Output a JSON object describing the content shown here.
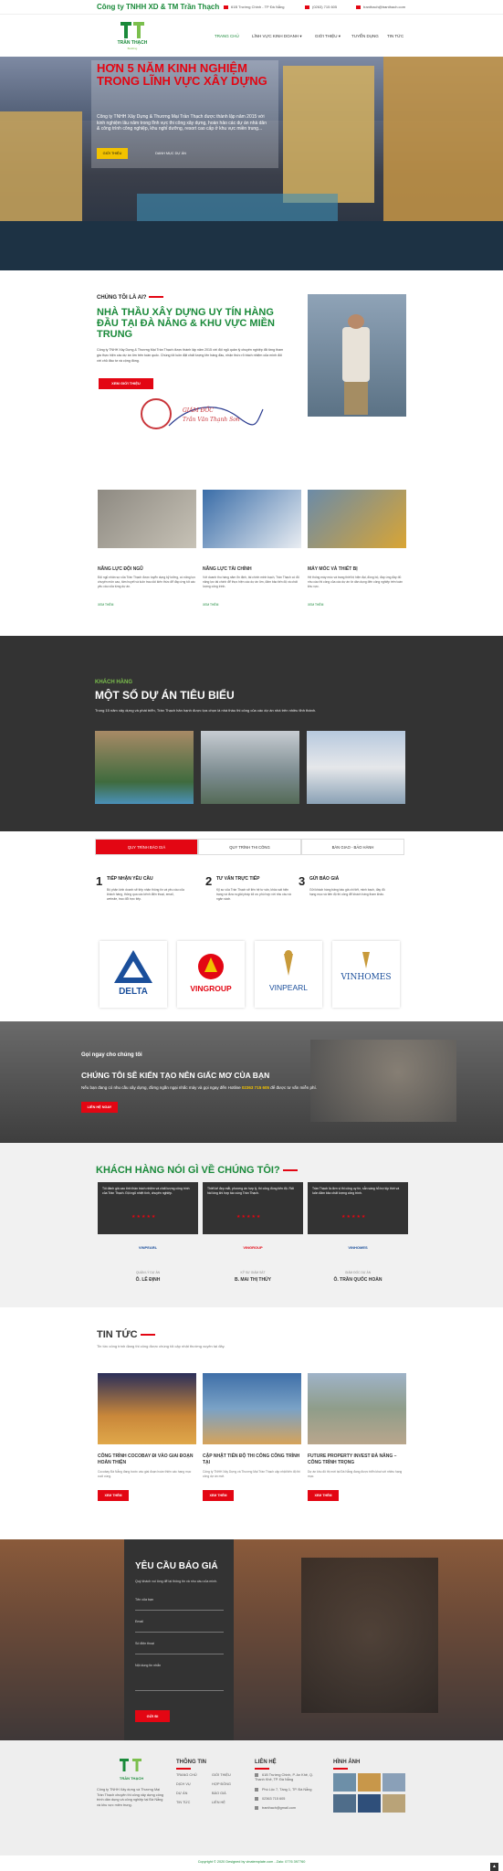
{
  "topbar": {
    "brand": "Công ty TNHH XD & TM Trần Thạch",
    "address": "61B Trường Chinh - TP Đà Nẵng",
    "phone": "(0263) 715 605",
    "email": "tranthach@tranthach.com"
  },
  "logo": {
    "name": "TRẦN THẠCH",
    "tagline": "Building"
  },
  "nav": {
    "items": [
      "TRANG CHỦ",
      "LĨNH VỰC KINH DOANH ▾",
      "GIỚI THIỆU ▾",
      "TUYỂN DỤNG",
      "TIN TỨC"
    ]
  },
  "hero": {
    "title": "HƠN 5 NĂM KINH NGHIỆM TRONG LĨNH VỰC XÂY DỰNG",
    "desc": "Công ty TNHH Xây Dựng & Thương Mại Trần Thạch được thành lập năm 2015 với kinh nghiệm lâu năm trong lĩnh vực thi công xây dựng, hoàn hảo các dự án nhà dân & công trình công nghiệp, khu nghỉ dưỡng, resort cao cấp ở khu vực miền trung...",
    "btn_primary": "GIỚI THIỆU",
    "btn_secondary": "DANH MỤC DỰ ÁN"
  },
  "about": {
    "kicker": "CHÚNG TÔI LÀ AI?",
    "title": "NHÀ THẦU XÂY DỰNG UY TÍN HÀNG ĐẦU TẠI ĐÀ NẴNG & KHU VỰC MIỀN TRUNG",
    "text": "Công ty TNHH Xây Dựng & Thương Mại Trần Thạch được thành lập năm 2015 với đội ngũ quản lý chuyên nghiệp đã từng tham gia thực hiện các dự án lớn trên toàn quốc. Chúng tôi luôn đặt chất lượng lên hàng đầu, nhận thức rõ trách nhiệm của mình đối với chủ đầu tư và cộng đồng.",
    "button": "XEM GIỚI THIỆU",
    "signature_title": "GIÁM ĐỐC",
    "signature_name": "Trần Văn Thạnh Sơn"
  },
  "capabilities": [
    {
      "title": "NĂNG LỰC ĐỘI NGŨ",
      "text": "Đội ngũ nhân sự của Trần Thạch được tuyển dụng kỹ lưỡng, có năng lực chuyên môn cao, tâm huyết và luôn trau dồi kiến thức để đáp ứng tốt các yêu cầu của từng dự án.",
      "link": "XEM THÊM"
    },
    {
      "title": "NĂNG LỰC TÀI CHÍNH",
      "text": "Với doanh thu hàng năm ổn định, tài chính minh bạch, Trần Thạch có đủ năng lực tài chính để thực hiện các dự án lớn, đảm bảo tiến độ và chất lượng công trình.",
      "link": "XEM THÊM"
    },
    {
      "title": "MÁY MÓC VÀ THIẾT BỊ",
      "text": "Hệ thống máy móc và trang thiết bị hiện đại, đồng bộ, đáp ứng đầy đủ nhu cầu thi công của các dự án từ dân dụng đến công nghiệp trên toàn khu vực.",
      "link": "XEM THÊM"
    }
  ],
  "projects": {
    "kicker": "KHÁCH HÀNG",
    "title": "MỘT SỐ DỰ ÁN TIÊU BIỂU",
    "sub": "Trong 15 năm xây dựng và phát triển, Trần Thạch hân hạnh được lựa chọn là nhà thầu thi công của các dự án nhà trên nhiều tỉnh thành."
  },
  "process": {
    "tabs": [
      "QUY TRÌNH BÁO GIÁ",
      "QUY TRÌNH THI CÔNG",
      "BÀN GIAO - BẢO HÀNH"
    ],
    "steps": [
      {
        "num": "1",
        "title": "TIẾP NHẬN YÊU CẦU",
        "text": "Bộ phận kinh doanh sẽ tiếp nhận thông tin và yêu cầu của khách hàng, thông qua các kênh điện thoại, email, website, trao đổi trực tiếp."
      },
      {
        "num": "2",
        "title": "TƯ VẤN TRỰC TIẾP",
        "text": "Kỹ sư của Trần Thạch sẽ liên hệ tư vấn, khảo sát hiện trạng và đưa ra giải pháp tối ưu phù hợp với nhu cầu và ngân sách."
      },
      {
        "num": "3",
        "title": "GỬI BÁO GIÁ",
        "text": "Gửi khách hàng bảng báo giá chi tiết, minh bạch, đầy đủ hạng mục và tiến độ thi công để khách hàng tham khảo."
      }
    ]
  },
  "partners": [
    "DELTA",
    "VINGROUP",
    "VINPEARL",
    "VINHOMES"
  ],
  "cta": {
    "t1": "Gọi ngay cho chúng tôi",
    "title": "CHÚNG TÔI SẼ KIẾN TẠO NÊN GIẤC MƠ CỦA BẠN",
    "text": "Nếu bạn đang có nhu cầu xây dựng, đừng ngần ngại nhấc máy và gọi ngay đến Hotline",
    "hotline": "02363 715 605",
    "text2": "để được tư vấn miễn phí.",
    "button": "LIÊN HỆ NGAY"
  },
  "testimonials": {
    "title": "KHÁCH HÀNG NÓI GÌ VỀ CHÚNG TÔI?",
    "items": [
      {
        "quote": "Tôi đánh giá cao tinh thần trách nhiệm và chất lượng công trình của Trần Thạch. Đội ngũ nhiệt tình, chuyên nghiệp.",
        "logo": "VINPEARL",
        "role": "QUẢN LÝ DỰ ÁN",
        "name": "Ô. LÊ ĐỊNH"
      },
      {
        "quote": "Thiết kế đẹp mắt, phương án hợp lý, thi công đúng tiến độ. Rất hài lòng khi hợp tác cùng Trần Thạch.",
        "logo": "VINGROUP",
        "role": "KỸ SƯ GIÁM SÁT",
        "name": "B. MAI THỊ THÚY"
      },
      {
        "quote": "Trần Thạch là đơn vị thi công uy tín, sẵn sàng hỗ trợ kịp thời và luôn đảm bảo chất lượng công trình.",
        "logo": "VINHOMES",
        "role": "GIÁM ĐỐC DỰ ÁN",
        "name": "Ô. TRẦN QUỐC HOÀN"
      }
    ],
    "stars": "★★★★★"
  },
  "news": {
    "title": "TIN TỨC",
    "sub": "Tin tức công trình đang thi công được chúng tôi cập nhật thường xuyên tại đây.",
    "items": [
      {
        "title": "CÔNG TRÌNH COCOBAY ĐI VÀO GIAI ĐOẠN HOÀN THIỆN",
        "text": "Cocobay Đà Nẵng đang bước vào giai đoạn hoàn thiện các hạng mục cuối cùng.",
        "button": "XEM THÊM"
      },
      {
        "title": "CẬP NHẬT TIẾN ĐỘ THI CÔNG CÔNG TRÌNH TẠI",
        "text": "Công ty TNHH Xây Dựng và Thương Mại Trần Thạch cập nhật tiến độ thi công dự án mới.",
        "button": "XEM THÊM"
      },
      {
        "title": "FUTURE PROPERTY INVEST ĐÀ NẴNG – CÔNG TRÌNH TRỌNG",
        "text": "Dự án khu đô thị mới tại Đà Nẵng đang được triển khai với nhiều hạng mục.",
        "button": "XEM THÊM"
      }
    ]
  },
  "quote": {
    "title": "YÊU CẦU BÁO GIÁ",
    "desc": "Quý khách vui lòng để lại thông tin và nhu cầu của mình.",
    "fields": [
      "Tên của bạn",
      "Email",
      "Số điện thoại",
      "Nội dung tin nhắn"
    ],
    "button": "GỬI ĐI"
  },
  "footer": {
    "about": "Công ty TNHH Xây dựng và Thương Mại Trần Thạch chuyên thi công xây dựng công trình dân dụng và công nghiệp tại Đà Nẵng và khu vực miền trung.",
    "col1_title": "THÔNG TIN",
    "col1_a": [
      "TRANG CHỦ",
      "DỊCH VỤ",
      "DỰ ÁN",
      "TIN TỨC"
    ],
    "col1_b": [
      "GIỚI THIỆU",
      "HỢP ĐỒNG",
      "BÁO GIÁ",
      "LIÊN HỆ"
    ],
    "col2_title": "LIÊN HỆ",
    "contacts": [
      "61B Trường Chinh, P. An Khê, Q. Thanh Khê, TP. Đà Nẵng",
      "Phú Lộc 7, Tầng 1, TP. Đà Nẵng",
      "02363 715 605",
      "tranthach@gmail.com"
    ],
    "col3_title": "HÌNH ẢNH",
    "copyright": "Copyright © 2020 Designed by vinatemplate.com - Zalo: 0776 397760"
  }
}
